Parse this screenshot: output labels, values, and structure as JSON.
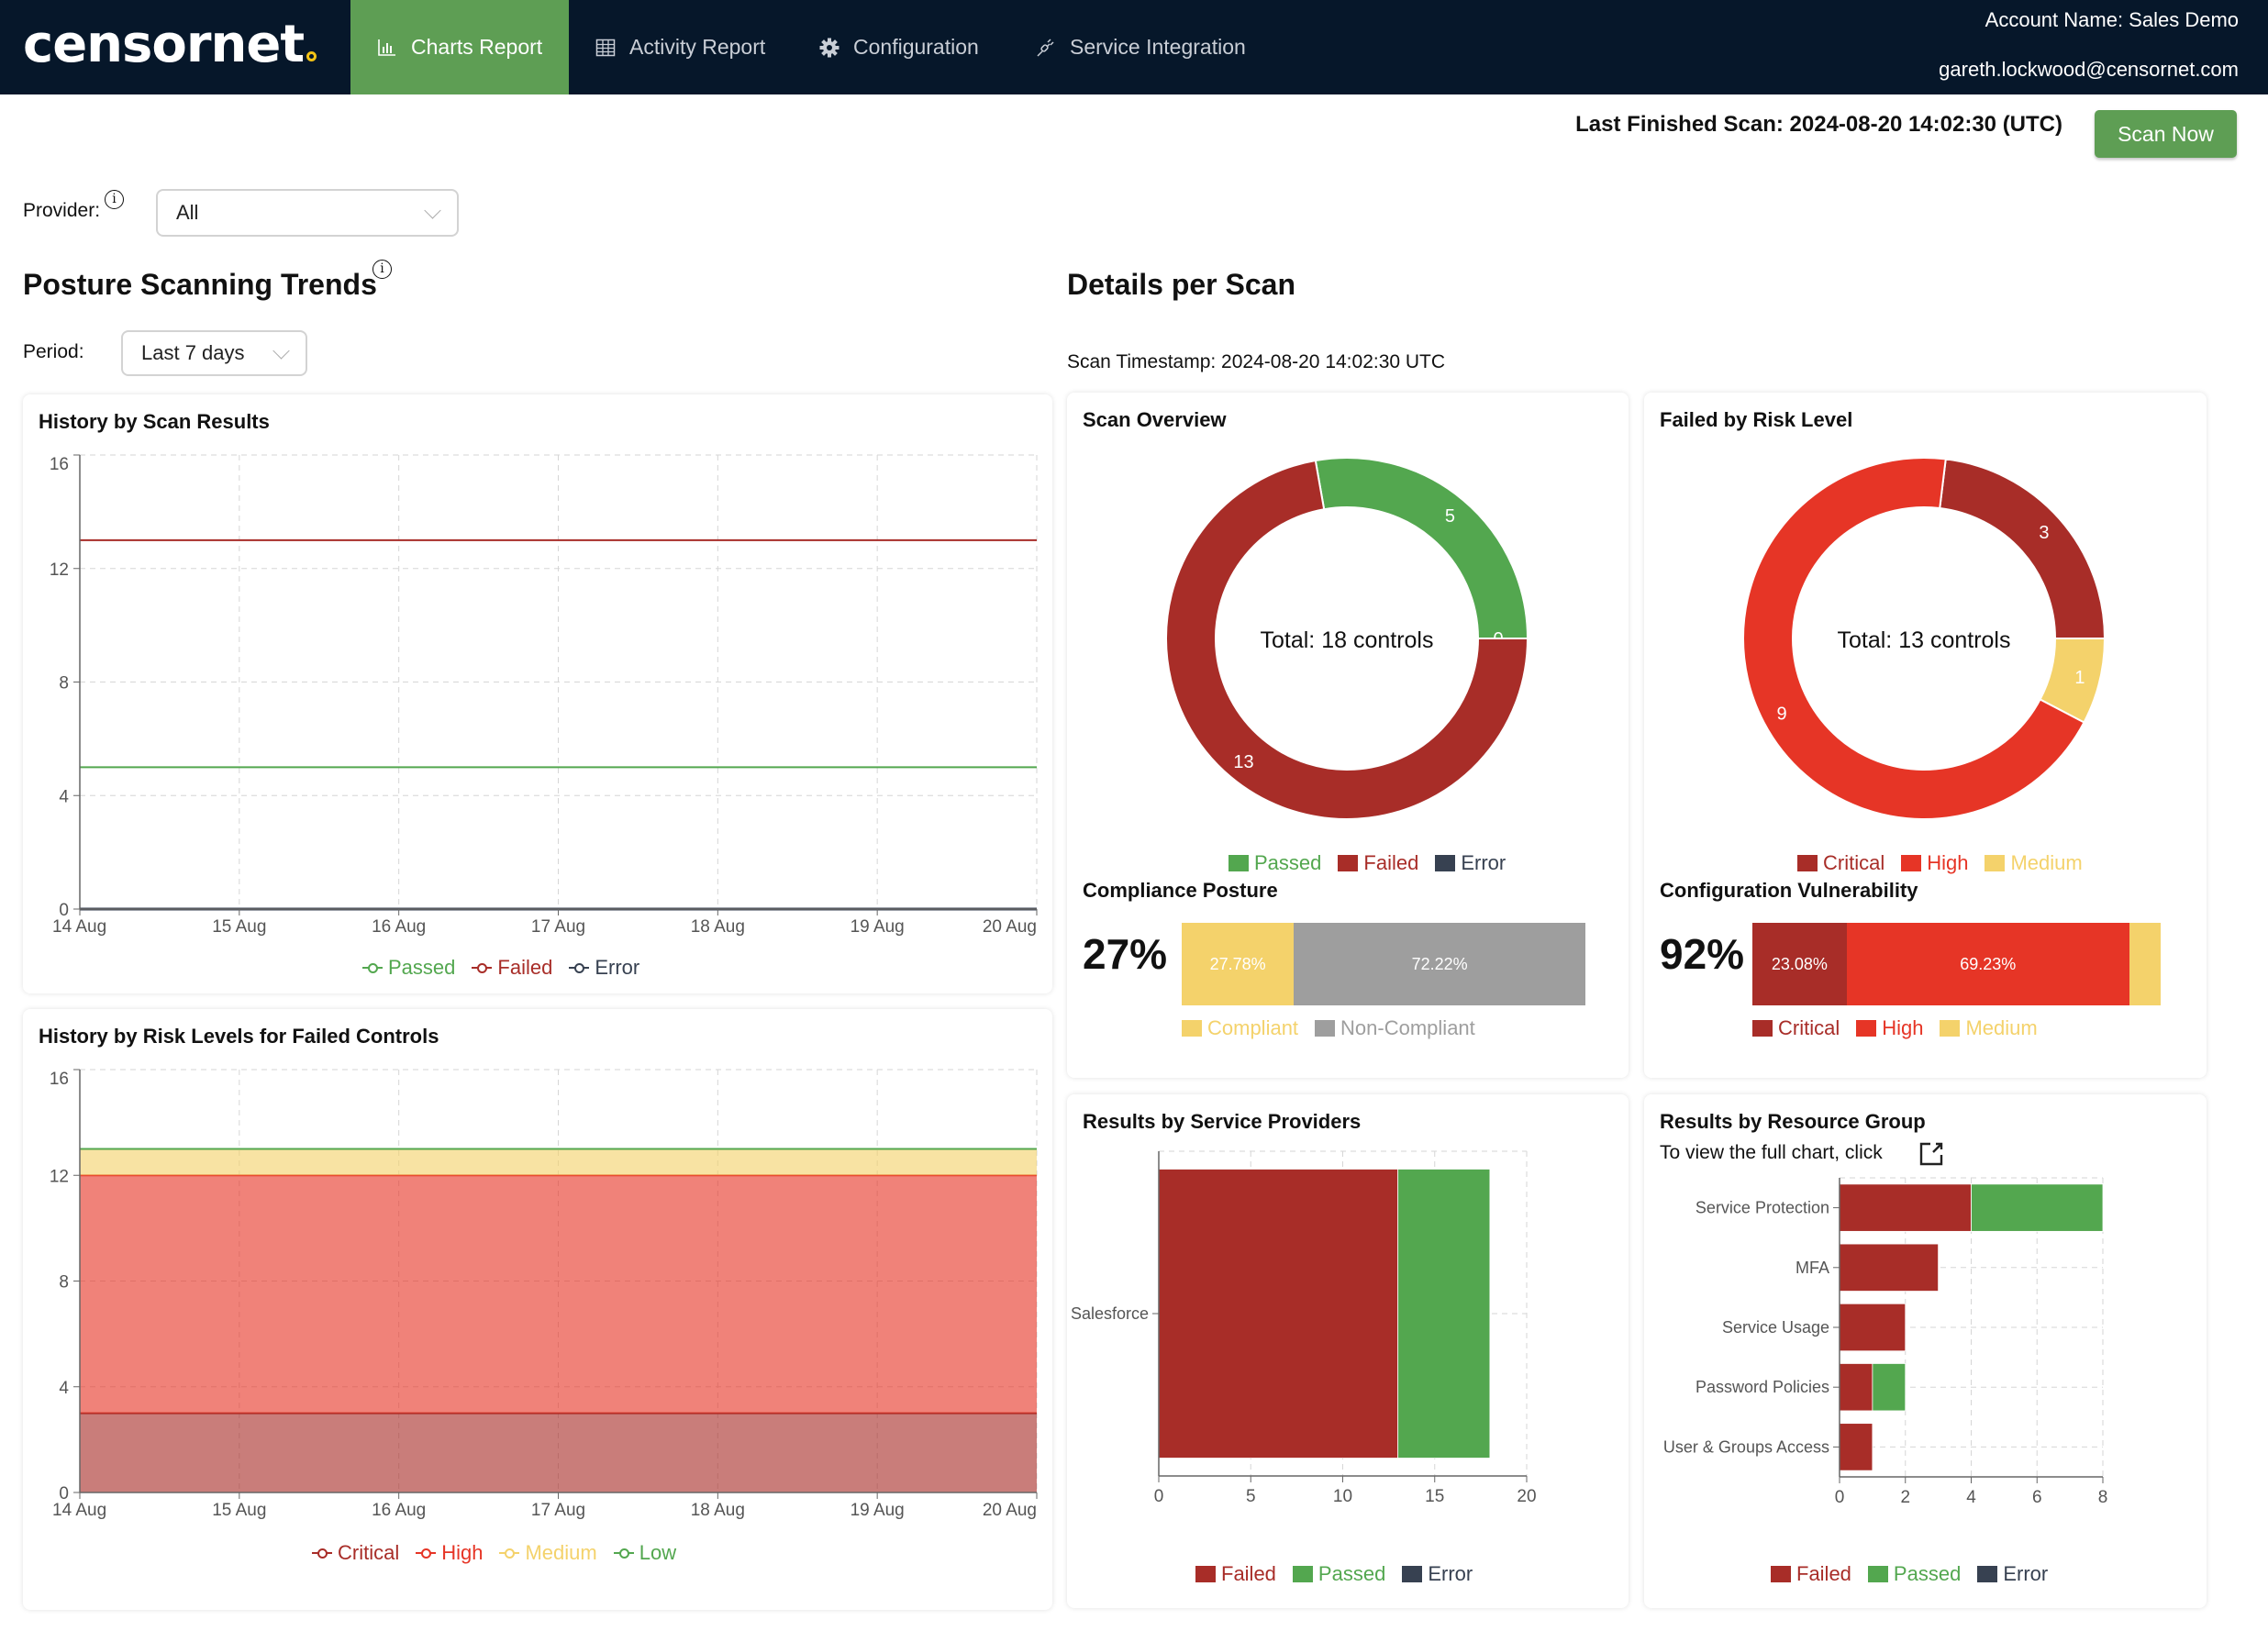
{
  "brand": {
    "name": "censornet",
    "accent": "#f3c316"
  },
  "nav": {
    "tabs": [
      {
        "label": "Charts Report",
        "icon": "bar-chart-icon",
        "active": true
      },
      {
        "label": "Activity Report",
        "icon": "table-icon",
        "active": false
      },
      {
        "label": "Configuration",
        "icon": "gear-icon",
        "active": false
      },
      {
        "label": "Service Integration",
        "icon": "plug-icon",
        "active": false
      }
    ],
    "account_name": "Account Name: Sales Demo",
    "email": "gareth.lockwood@censornet.com"
  },
  "scan": {
    "last_finished": "Last Finished Scan: 2024-08-20 14:02:30 (UTC)",
    "scan_now_label": "Scan Now"
  },
  "filters": {
    "provider_label": "Provider:",
    "provider_value": "All",
    "period_label": "Period:",
    "period_value": "Last 7 days"
  },
  "trends": {
    "title": "Posture Scanning Trends"
  },
  "details": {
    "title": "Details per Scan",
    "timestamp": "Scan Timestamp: 2024-08-20 14:02:30 UTC"
  },
  "colors": {
    "passed": "#53a74f",
    "failed": "#a82d28",
    "error": "#374151",
    "critical": "#a82d28",
    "high": "#e63526",
    "medium": "#f4d26b",
    "low": "#53a74f",
    "noncompliant": "#9e9e9e",
    "compliant": "#f4d26b"
  },
  "chart_data": [
    {
      "id": "history-scan-results",
      "type": "line",
      "title": "History by Scan Results",
      "x": [
        "14 Aug",
        "15 Aug",
        "16 Aug",
        "17 Aug",
        "18 Aug",
        "19 Aug",
        "20 Aug"
      ],
      "series": [
        {
          "name": "Passed",
          "values": [
            5,
            5,
            5,
            5,
            5,
            5,
            5
          ]
        },
        {
          "name": "Failed",
          "values": [
            13,
            13,
            13,
            13,
            13,
            13,
            13
          ]
        },
        {
          "name": "Error",
          "values": [
            0,
            0,
            0,
            0,
            0,
            0,
            0
          ]
        }
      ],
      "yticks": [
        0,
        4,
        8,
        12,
        16
      ],
      "ylim": [
        0,
        16
      ],
      "grid": true,
      "legend": "bottom"
    },
    {
      "id": "history-risk-levels",
      "type": "area",
      "stacked": true,
      "title": "History by Risk Levels for Failed Controls",
      "x": [
        "14 Aug",
        "15 Aug",
        "16 Aug",
        "17 Aug",
        "18 Aug",
        "19 Aug",
        "20 Aug"
      ],
      "series": [
        {
          "name": "Critical",
          "values": [
            3,
            3,
            3,
            3,
            3,
            3,
            3
          ]
        },
        {
          "name": "High",
          "values": [
            9,
            9,
            9,
            9,
            9,
            9,
            9
          ]
        },
        {
          "name": "Medium",
          "values": [
            1,
            1,
            1,
            1,
            1,
            1,
            1
          ]
        },
        {
          "name": "Low",
          "values": [
            0,
            0,
            0,
            0,
            0,
            0,
            0
          ]
        }
      ],
      "yticks": [
        0,
        4,
        8,
        12,
        16
      ],
      "ylim": [
        0,
        16
      ],
      "grid": true,
      "legend": "bottom"
    },
    {
      "id": "scan-overview",
      "type": "pie",
      "donut": true,
      "title": "Scan Overview",
      "center_label": "Total: 18 controls",
      "slices": [
        {
          "name": "Passed",
          "value": 5
        },
        {
          "name": "Error",
          "value": 0
        },
        {
          "name": "Failed",
          "value": 13
        }
      ],
      "legend_order": [
        "Passed",
        "Failed",
        "Error"
      ],
      "legend": "bottom"
    },
    {
      "id": "failed-by-risk",
      "type": "pie",
      "donut": true,
      "title": "Failed by Risk Level",
      "center_label": "Total: 13 controls",
      "slices": [
        {
          "name": "Critical",
          "value": 3
        },
        {
          "name": "Medium",
          "value": 1
        },
        {
          "name": "High",
          "value": 9
        }
      ],
      "legend_order": [
        "Critical",
        "High",
        "Medium"
      ],
      "legend": "bottom"
    },
    {
      "id": "compliance-posture",
      "type": "bar",
      "stacked": true,
      "title": "Compliance Posture",
      "headline": "27%",
      "segments": [
        {
          "name": "Compliant",
          "value": 27.78,
          "label": "27.78%"
        },
        {
          "name": "Non-Compliant",
          "value": 72.22,
          "label": "72.22%"
        }
      ],
      "legend": "bottom"
    },
    {
      "id": "configuration-vulnerability",
      "type": "bar",
      "stacked": true,
      "title": "Configuration Vulnerability",
      "headline": "92%",
      "segments": [
        {
          "name": "Critical",
          "value": 23.08,
          "label": "23.08%"
        },
        {
          "name": "High",
          "value": 69.23,
          "label": "69.23%"
        },
        {
          "name": "Medium",
          "value": 7.69,
          "label": ""
        }
      ],
      "legend": "bottom"
    },
    {
      "id": "results-by-service-providers",
      "type": "bar",
      "orientation": "horizontal",
      "stacked": true,
      "title": "Results by Service Providers",
      "categories": [
        "Salesforce"
      ],
      "series": [
        {
          "name": "Failed",
          "values": [
            13
          ]
        },
        {
          "name": "Passed",
          "values": [
            5
          ]
        },
        {
          "name": "Error",
          "values": [
            0
          ]
        }
      ],
      "xticks": [
        0,
        5,
        10,
        15,
        20
      ],
      "xlim": [
        0,
        20
      ],
      "grid": true,
      "legend": "bottom"
    },
    {
      "id": "results-by-resource-group",
      "type": "bar",
      "orientation": "horizontal",
      "stacked": true,
      "title": "Results by Resource Group",
      "note": "To view the full chart, click",
      "categories": [
        "Service Protection",
        "MFA",
        "Service Usage",
        "Password Policies",
        "User & Groups Access"
      ],
      "series": [
        {
          "name": "Failed",
          "values": [
            4,
            3,
            2,
            1,
            1
          ]
        },
        {
          "name": "Passed",
          "values": [
            4,
            0,
            0,
            1,
            0
          ]
        },
        {
          "name": "Error",
          "values": [
            0,
            0,
            0,
            0,
            0
          ]
        }
      ],
      "xticks": [
        0,
        2,
        4,
        6,
        8
      ],
      "xlim": [
        0,
        8
      ],
      "grid": true,
      "legend": "bottom"
    }
  ]
}
